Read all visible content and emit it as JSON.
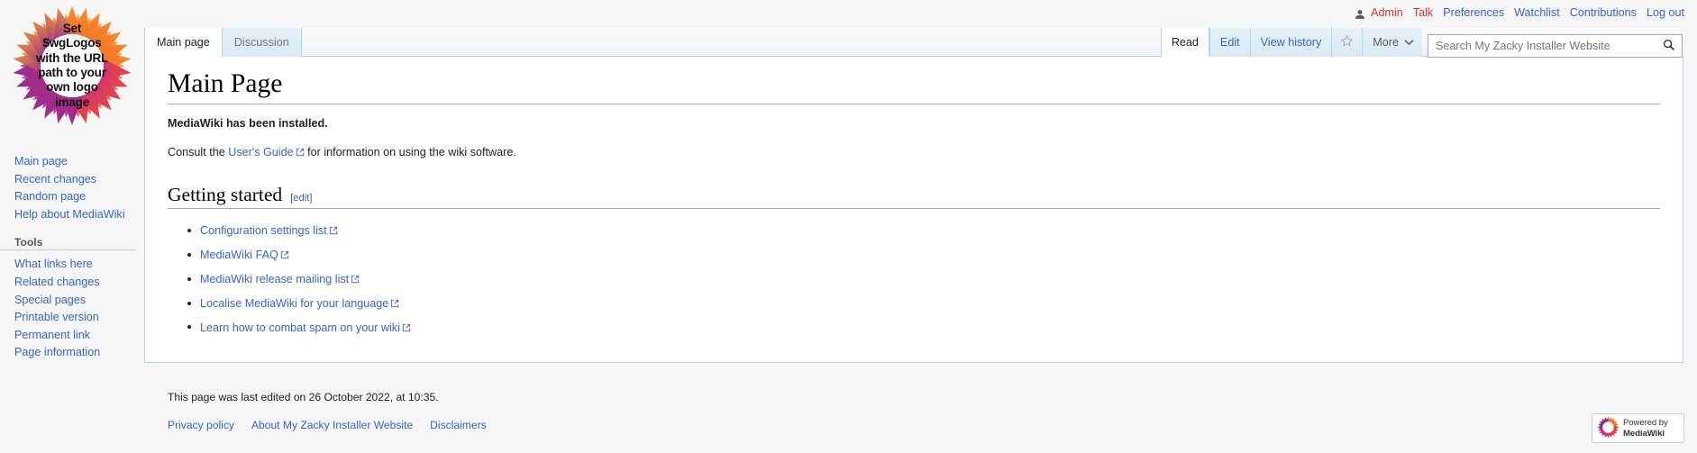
{
  "user_links": {
    "icon": "person-icon",
    "items": [
      {
        "label": "Admin",
        "style": "red"
      },
      {
        "label": "Talk",
        "style": "red"
      },
      {
        "label": "Preferences",
        "style": "blue"
      },
      {
        "label": "Watchlist",
        "style": "blue"
      },
      {
        "label": "Contributions",
        "style": "blue"
      },
      {
        "label": "Log out",
        "style": "blue"
      }
    ]
  },
  "logo": {
    "name": "mediawiki-sunflower-logo",
    "overlay_lines": [
      "Set",
      "$wgLogos",
      "with the URL",
      "path to your",
      "own logo",
      "image"
    ],
    "colors": [
      "#f47421",
      "#e8442f",
      "#c3318a",
      "#8a2d8a"
    ]
  },
  "namespace_tabs": [
    {
      "label": "Main page",
      "active": true
    },
    {
      "label": "Discussion",
      "active": false
    }
  ],
  "view_tabs": [
    {
      "label": "Read",
      "active": true,
      "icon": ""
    },
    {
      "label": "Edit",
      "active": false,
      "icon": ""
    },
    {
      "label": "View history",
      "active": false,
      "icon": ""
    },
    {
      "label": "",
      "active": false,
      "icon": "star-icon"
    },
    {
      "label": "More",
      "active": false,
      "icon": "chevron-down-icon"
    }
  ],
  "search": {
    "placeholder": "Search My Zacky Installer Website",
    "value": "",
    "icon": "search-icon"
  },
  "sidebar": {
    "navigation": {
      "heading": "",
      "items": [
        {
          "label": "Main page"
        },
        {
          "label": "Recent changes"
        },
        {
          "label": "Random page"
        },
        {
          "label": "Help about MediaWiki"
        }
      ]
    },
    "tools": {
      "heading": "Tools",
      "items": [
        {
          "label": "What links here"
        },
        {
          "label": "Related changes"
        },
        {
          "label": "Special pages"
        },
        {
          "label": "Printable version"
        },
        {
          "label": "Permanent link"
        },
        {
          "label": "Page information"
        }
      ]
    }
  },
  "article": {
    "title": "Main Page",
    "installed_notice": "MediaWiki has been installed.",
    "consult": {
      "before": "Consult the ",
      "link": "User's Guide",
      "after": " for information on using the wiki software."
    },
    "section": {
      "heading": "Getting started",
      "edit_open": "[",
      "edit_label": "edit",
      "edit_close": "]",
      "links": [
        {
          "label": "Configuration settings list"
        },
        {
          "label": "MediaWiki FAQ"
        },
        {
          "label": "MediaWiki release mailing list"
        },
        {
          "label": "Localise MediaWiki for your language"
        },
        {
          "label": "Learn how to combat spam on your wiki"
        }
      ]
    }
  },
  "footer": {
    "last_edited": "This page was last edited on 26 October 2022, at 10:35.",
    "places": [
      {
        "label": "Privacy policy"
      },
      {
        "label": "About My Zacky Installer Website"
      },
      {
        "label": "Disclaimers"
      }
    ],
    "powered_by": {
      "line1": "Powered by",
      "line2": "MediaWiki",
      "icon": "mediawiki-sunflower-icon"
    }
  },
  "theme": {
    "link_blue": "#3366cc",
    "link_red": "#d73333",
    "page_bg": "#f6f6f6",
    "content_bg": "#ffffff",
    "tab_border": "#a7d7f9",
    "rule": "#a2a9b1"
  }
}
